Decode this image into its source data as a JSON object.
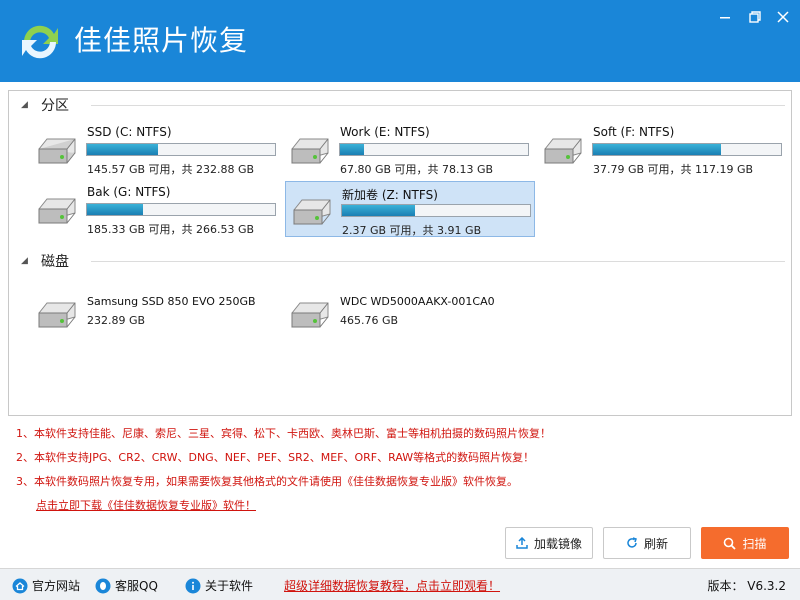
{
  "app": {
    "title": "佳佳照片恢复"
  },
  "window": {
    "minimize": "minimize",
    "maximize": "maximize",
    "close": "close"
  },
  "partitions": {
    "label": "分区",
    "items": [
      {
        "name": "SSD (C: NTFS)",
        "capacity": "145.57 GB 可用，共 232.88 GB",
        "used_fraction": 0.375,
        "selected": false
      },
      {
        "name": "Work (E: NTFS)",
        "capacity": "67.80 GB 可用，共 78.13 GB",
        "used_fraction": 0.13,
        "selected": false
      },
      {
        "name": "Soft (F: NTFS)",
        "capacity": "37.79 GB 可用，共 117.19 GB",
        "used_fraction": 0.68,
        "selected": false
      },
      {
        "name": "Bak (G: NTFS)",
        "capacity": "185.33 GB 可用，共 266.53 GB",
        "used_fraction": 0.3,
        "selected": false
      },
      {
        "name": "新加卷 (Z: NTFS)",
        "capacity": "2.37 GB 可用，共 3.91 GB",
        "used_fraction": 0.39,
        "selected": true
      }
    ]
  },
  "disks": {
    "label": "磁盘",
    "items": [
      {
        "name": "Samsung SSD 850 EVO 250GB",
        "capacity": "232.89 GB"
      },
      {
        "name": "WDC WD5000AAKX-001CA0",
        "capacity": "465.76 GB"
      }
    ]
  },
  "notes": [
    "1、本软件支持佳能、尼康、索尼、三星、宾得、松下、卡西欧、奥林巴斯、富士等相机拍摄的数码照片恢复！",
    "2、本软件支持JPG、CR2、CRW、DNG、NEF、PEF、SR2、MEF、ORF、RAW等格式的数码照片恢复！",
    "3、本软件数码照片恢复专用，如果需要恢复其他格式的文件请使用《佳佳数据恢复专业版》软件恢复。"
  ],
  "download_link": "点击立即下载《佳佳数据恢复专业版》软件！",
  "buttons": {
    "load_image": "加载镜像",
    "refresh": "刷新",
    "scan": "扫描"
  },
  "statusbar": {
    "website": "官方网站",
    "qq": "客服QQ",
    "about": "关于软件",
    "tutorial": "超级详细数据恢复教程，点击立即观看！",
    "version": "版本： V6.3.2"
  },
  "colors": {
    "titlebar": "#1a86d8",
    "scan_button": "#f56c2d",
    "note_text": "#d0140e",
    "selected_bg": "#cfe3f7"
  }
}
